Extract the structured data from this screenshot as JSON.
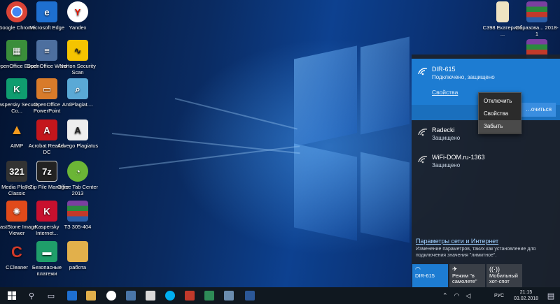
{
  "desktop_icons": [
    {
      "label": "Google Chrome",
      "icon": "chrome-icon",
      "color": "#db4437"
    },
    {
      "label": "Microsoft Edge",
      "icon": "edge-icon",
      "color": "#1e6fd0"
    },
    {
      "label": "Yandex",
      "icon": "yandex-icon",
      "color": "#ffffff"
    },
    {
      "label": "OpenOffice Excel",
      "icon": "spreadsheet-icon",
      "color": "#3a8e3a"
    },
    {
      "label": "OpenOffice Word",
      "icon": "document-icon",
      "color": "#4d6f9f"
    },
    {
      "label": "Norton Security Scan",
      "icon": "norton-icon",
      "color": "#f5c400"
    },
    {
      "label": "Kaspersky Secure Co...",
      "icon": "kaspersky-icon",
      "color": "#0f9d6f"
    },
    {
      "label": "OpenOffice PowerPoint",
      "icon": "presentation-icon",
      "color": "#d87b2a"
    },
    {
      "label": "AntiPlagiat....",
      "icon": "antiplagiat-icon",
      "color": "#5aa9d6"
    },
    {
      "label": "AIMP",
      "icon": "aimp-icon",
      "color": "#f39a1d"
    },
    {
      "label": "Acrobat Reader DC",
      "icon": "acrobat-icon",
      "color": "#c4161c"
    },
    {
      "label": "Advego Plagiatus",
      "icon": "advego-icon",
      "color": "#eeeeee"
    },
    {
      "label": "Media Player Classic",
      "icon": "media-player-icon",
      "color": "#333333"
    },
    {
      "label": "7-Zip File Manager",
      "icon": "7zip-icon",
      "color": "#222222"
    },
    {
      "label": "Office Tab Center 2013",
      "icon": "office-tab-icon",
      "color": "#6bb536"
    },
    {
      "label": "FastStone Image Viewer",
      "icon": "faststone-icon",
      "color": "#e04a1a"
    },
    {
      "label": "Kaspersky Internet...",
      "icon": "kaspersky-internet-icon",
      "color": "#c8102e"
    },
    {
      "label": "ТЗ 305-404",
      "icon": "winrar-archive-icon",
      "color": "#7b3fa0"
    },
    {
      "label": "CCleaner",
      "icon": "ccleaner-icon",
      "color": "#d23a2a"
    },
    {
      "label": "Безопасные платежи",
      "icon": "safe-payment-icon",
      "color": "#1f9e6a"
    },
    {
      "label": "работа",
      "icon": "folder-icon",
      "color": "#e2b04b"
    }
  ],
  "right_icons": [
    {
      "label": "С398 Екатерина ...",
      "icon": "archive-file-icon"
    },
    {
      "label": "Образова... 2018-1",
      "icon": "winrar-archive-icon"
    },
    {
      "label": "",
      "icon": "winrar-archive-icon"
    }
  ],
  "flyout": {
    "active": {
      "name": "DIR-615",
      "status": "Подключено, защищено",
      "properties_link": "Свойства",
      "connect_button": "…очиться"
    },
    "context_menu": [
      "Отключить",
      "Свойства",
      "Забыть"
    ],
    "networks": [
      {
        "name": "Radecki",
        "status": "Защищено"
      },
      {
        "name": "WiFi-DOM.ru-1363",
        "status": "Защищено"
      }
    ],
    "settings_title": "Параметры сети и Интернет",
    "settings_desc": "Изменение параметров, таких как установление для подключения значения \"лимитное\".",
    "tiles": [
      {
        "label": "DIR-615",
        "icon": "wifi-icon",
        "active": true
      },
      {
        "label": "Режим \"в самолете\"",
        "icon": "airplane-icon",
        "active": false
      },
      {
        "label": "Мобильный хот-спот",
        "icon": "hotspot-icon",
        "active": false
      }
    ]
  },
  "taskbar": {
    "language": "РУС",
    "time": "21:15",
    "date": "03.02.2018"
  },
  "colors": {
    "accent": "#1d7cd2",
    "flyout_bg": "#1c222c",
    "taskbar_bg": "#101820"
  }
}
